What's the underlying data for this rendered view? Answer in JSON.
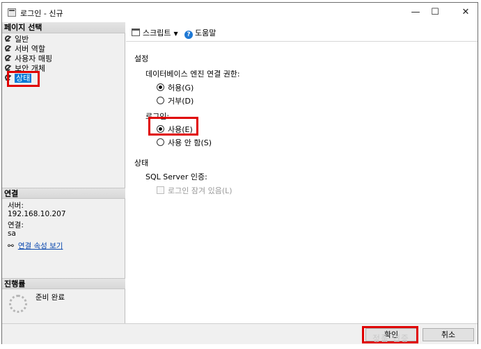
{
  "window": {
    "title": "로그인 - 신규",
    "min_glyph": "—",
    "max_glyph": "☐",
    "close_glyph": "✕"
  },
  "left": {
    "select_page_header": "페이지 선택",
    "pages": [
      {
        "label": "일반",
        "icon": "wrench-icon"
      },
      {
        "label": "서버 역할",
        "icon": "wrench-icon"
      },
      {
        "label": "사용자 매핑",
        "icon": "wrench-icon"
      },
      {
        "label": "보안 개체",
        "icon": "wrench-icon"
      },
      {
        "label": "상태",
        "icon": "wrench-icon",
        "selected": true
      }
    ],
    "connection_header": "연결",
    "server_label": "서버:",
    "server_value": "192.168.10.207",
    "connection_label": "연결:",
    "connection_value": "sa",
    "view_properties_link": "연결 속성 보기",
    "progress_header": "진행률",
    "progress_status": "준비 완료"
  },
  "toolbar": {
    "script_label": "스크립트",
    "help_label": "도움말",
    "help_glyph": "?"
  },
  "main": {
    "settings_header": "설정",
    "db_engine_permission_label": "데이터베이스 엔진 연결 권한:",
    "grant_option": "허용(G)",
    "deny_option": "거부(D)",
    "grant_selected": true,
    "login_label": "로그인:",
    "enabled_option": "사용(E)",
    "disabled_option": "사용 안 함(S)",
    "enabled_selected": true,
    "status_header": "상태",
    "sql_auth_label": "SQL Server 인증:",
    "locked_out_label": "로그인 잠겨 있음(L)"
  },
  "buttons": {
    "ok": "확인",
    "cancel": "취소"
  },
  "watermark": "정품 인증",
  "colors": {
    "highlight": "#e00000",
    "selection": "#0078d7",
    "link": "#0645ad"
  }
}
